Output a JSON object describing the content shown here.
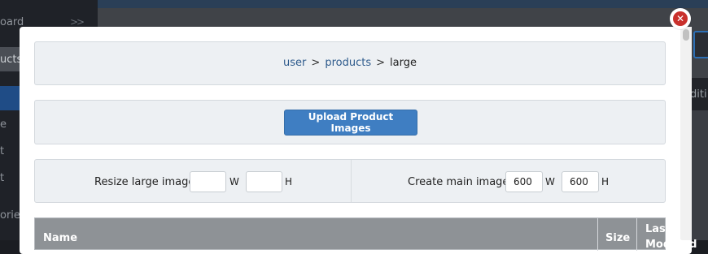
{
  "background": {
    "sidebar_items": [
      "oard",
      "ucts",
      "e",
      "t",
      "t",
      "orie"
    ],
    "sidebar_chevron": ">>",
    "right_partial_text": "diti"
  },
  "modal": {
    "close_icon": "close-icon",
    "breadcrumb": {
      "items": [
        "user",
        "products",
        "large"
      ],
      "separator": ">"
    },
    "upload": {
      "button_label": "Upload Product Images",
      "button_color": "#3f7ec2"
    },
    "resize": {
      "label": "Resize large image:",
      "width_value": "",
      "height_value": "",
      "width_unit": "W",
      "height_unit": "H"
    },
    "main_image": {
      "label": "Create main image:",
      "width_value": "600",
      "height_value": "600",
      "width_unit": "W",
      "height_unit": "H"
    },
    "table": {
      "columns": [
        "Name",
        "Size",
        "Last Modified"
      ]
    }
  }
}
